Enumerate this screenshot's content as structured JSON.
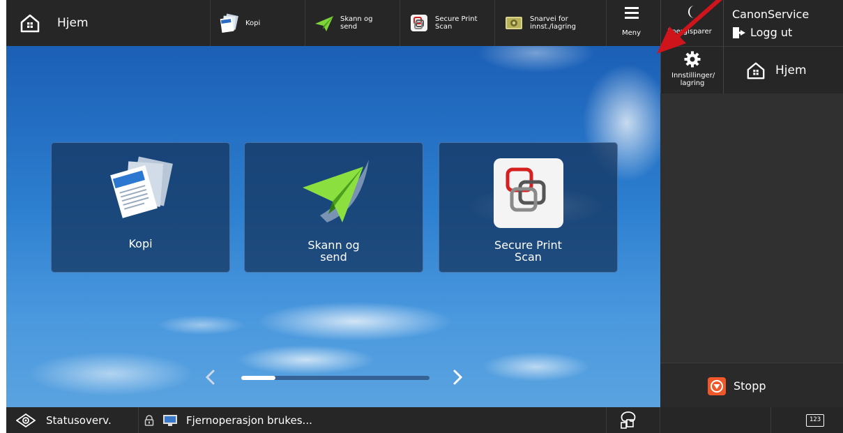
{
  "topbar": {
    "home_label": "Hjem",
    "quick_buttons": [
      {
        "label": "Kopi",
        "icon": "copy-icon"
      },
      {
        "label": "Skann og send",
        "icon": "scan-send-icon"
      },
      {
        "label": "Secure Print Scan",
        "icon": "secure-print-icon"
      },
      {
        "label": "Snarvei for innst./lagring",
        "icon": "shortcut-icon"
      }
    ],
    "menu_label": "Meny"
  },
  "right_panel": {
    "energy_label": "Energisparer",
    "user_name": "CanonService",
    "logout_label": "Logg ut",
    "settings_label": "Innstillinger/ lagring",
    "home_label": "Hjem",
    "stop_label": "Stopp"
  },
  "main": {
    "tiles": [
      {
        "label": "Kopi",
        "icon": "copy-icon"
      },
      {
        "label": "Skann og send",
        "icon": "scan-send-icon"
      },
      {
        "label": "Secure Print Scan",
        "icon": "secure-print-icon"
      }
    ],
    "pager": {
      "page_fraction": 0.18
    }
  },
  "bottombar": {
    "status_label": "Statusoverv.",
    "remote_label": "Fjernoperasjon brukes...",
    "keypad_label": "123"
  },
  "colors": {
    "bar_bg": "#262626",
    "panel_bg": "#303030",
    "stop_orange": "#f0582a",
    "annotation_arrow": "#d0141c"
  }
}
